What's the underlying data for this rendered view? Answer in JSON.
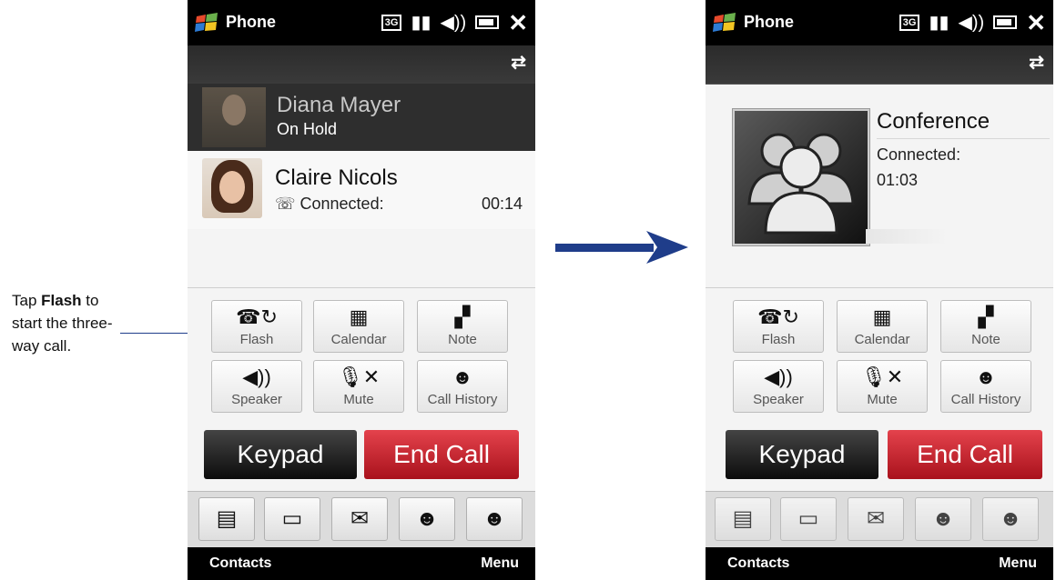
{
  "caption": {
    "prefix": "Tap",
    "bold": "Flash",
    "rest": "to start the three-way call."
  },
  "phone_left": {
    "status_title": "Phone",
    "held_call": {
      "name": "Diana Mayer",
      "status": "On Hold"
    },
    "active_call": {
      "name": "Claire Nicols",
      "status": "Connected:",
      "timer": "00:14"
    },
    "buttons": [
      {
        "label": "Flash",
        "icon": "flash-icon"
      },
      {
        "label": "Calendar",
        "icon": "calendar-icon"
      },
      {
        "label": "Note",
        "icon": "note-icon"
      },
      {
        "label": "Speaker",
        "icon": "speaker-icon"
      },
      {
        "label": "Mute",
        "icon": "mute-icon"
      },
      {
        "label": "Call History",
        "icon": "call-history-icon"
      }
    ],
    "keypad_label": "Keypad",
    "end_call_label": "End Call",
    "softkey_left": "Contacts",
    "softkey_right": "Menu"
  },
  "phone_right": {
    "status_title": "Phone",
    "conference": {
      "title": "Conference",
      "status": "Connected:",
      "time": "01:03"
    },
    "buttons": [
      {
        "label": "Flash",
        "icon": "flash-icon"
      },
      {
        "label": "Calendar",
        "icon": "calendar-icon"
      },
      {
        "label": "Note",
        "icon": "note-icon"
      },
      {
        "label": "Speaker",
        "icon": "speaker-icon"
      },
      {
        "label": "Mute",
        "icon": "mute-icon"
      },
      {
        "label": "Call History",
        "icon": "call-history-icon"
      }
    ],
    "keypad_label": "Keypad",
    "end_call_label": "End Call",
    "softkey_left": "Contacts",
    "softkey_right": "Menu"
  },
  "tabs": [
    "contact-card-icon",
    "message-icon",
    "email-icon",
    "call-history-icon",
    "speed-dial-icon"
  ],
  "colors": {
    "end_call": "#c8202b",
    "arrow": "#1f3d8a"
  }
}
